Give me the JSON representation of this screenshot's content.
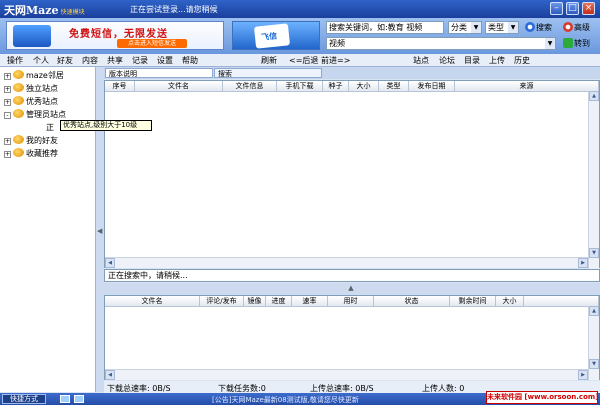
{
  "app": {
    "logo": "天网Maze",
    "logo_sub": "快速模块",
    "status": "正在尝试登录...请您稍候"
  },
  "banner": {
    "slogan": "免费短信，无限发送",
    "button": "点击进入短信发送",
    "card_text": "飞信"
  },
  "search": {
    "hint": "搜索关键词，如:教育 视频",
    "category": "分类",
    "type": "类型",
    "search_label": "搜索",
    "advanced_label": "高级",
    "query": "视频",
    "go_label": "转到"
  },
  "menu": {
    "items": [
      "操作",
      "个人",
      "好友",
      "内容",
      "共享",
      "记录",
      "设置",
      "帮助"
    ],
    "toolbar": [
      "刷新",
      "<=后退",
      "前进=>"
    ],
    "right": [
      "站点",
      "论坛",
      "目录",
      "上传",
      "历史"
    ]
  },
  "tree": {
    "nodes": [
      "maze邻居",
      "独立站点",
      "优秀站点",
      "管理员站点",
      "正",
      "我的好友",
      "收藏推荐"
    ],
    "tooltip": "优秀站点,级别大于10级"
  },
  "tabs": [
    "版本说明",
    "搜索"
  ],
  "top_columns": [
    "序号",
    "文件名",
    "文件信息",
    "手机下载",
    "种子",
    "大小",
    "类型",
    "发布日期",
    "来源"
  ],
  "searching_text": "正在搜索中，请稍候...",
  "bottom_columns": [
    "文件名",
    "评论/发布",
    "镜像",
    "进度",
    "速率",
    "用时",
    "状态",
    "剩余时间",
    "大小"
  ],
  "stats": {
    "download_rate": "下载总速率: 0B/S",
    "download_tasks": "下载任务数:0",
    "upload_rate": "上传总速率: 0B/S",
    "uploaders": "上传人数: 0"
  },
  "statusbar": {
    "quick_mode": "快捷方式",
    "message": "[公告]天网Maze最新08测试版,敬请您尽快更新",
    "watermark": "未来软件园 [www.orsoon.com]"
  },
  "colors": {
    "accent": "#2f63c8",
    "title_text": "#ffffff",
    "slogan": "#d01010"
  }
}
